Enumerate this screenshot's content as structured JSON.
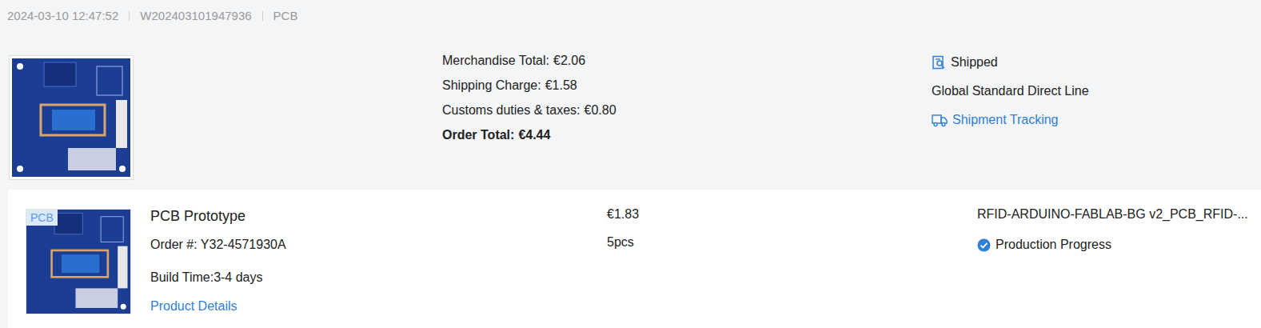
{
  "order_header": {
    "datetime": "2024-03-10 12:47:52",
    "order_id": "W202403101947936",
    "category": "PCB"
  },
  "summary": {
    "lines": [
      {
        "label": "Merchandise Total:",
        "value": "€2.06"
      },
      {
        "label": "Shipping Charge:",
        "value": "€1.58"
      },
      {
        "label": "Customs duties & taxes:",
        "value": "€0.80"
      }
    ],
    "total": {
      "label": "Order Total:",
      "value": "€4.44"
    }
  },
  "status": {
    "label": "Shipped",
    "shipping_method": "Global Standard Direct Line",
    "tracking_link": "Shipment Tracking"
  },
  "item": {
    "badge": "PCB",
    "name": "PCB Prototype",
    "order_number": "Order #: Y32-4571930A",
    "build_time": "Build Time:3-4 days",
    "details_link": "Product Details",
    "price": "€1.83",
    "quantity": "5pcs",
    "file_name": "RFID-ARDUINO-FABLAB-BG v2_PCB_RFID-...",
    "progress": {
      "label": "Production Progress",
      "done": true
    }
  }
}
